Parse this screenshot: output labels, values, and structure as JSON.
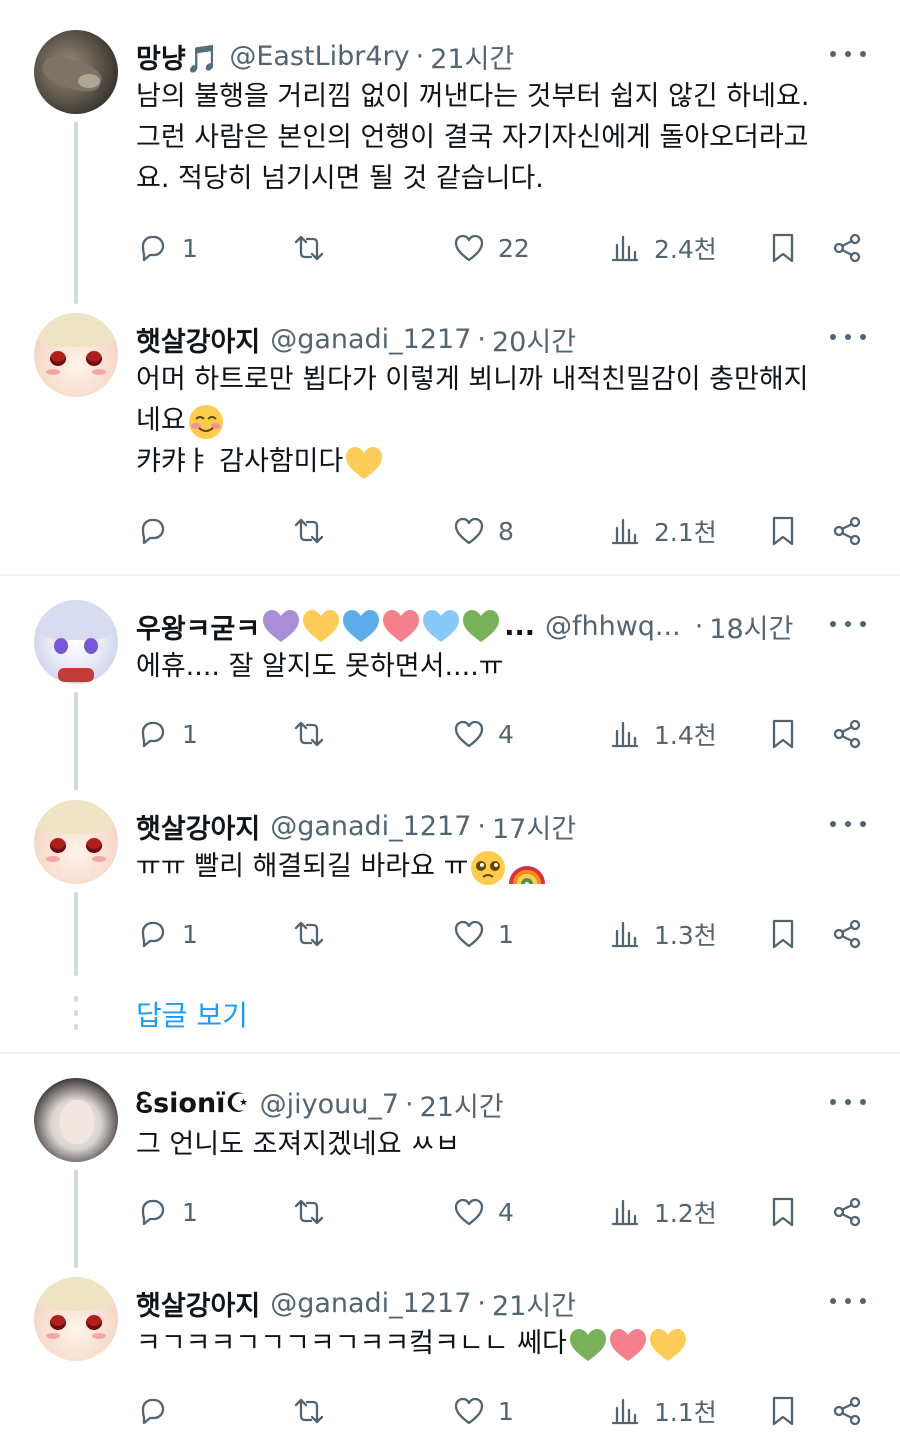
{
  "tweets": [
    {
      "display_name": "망냥🎵",
      "handle": "@EastLibr4ry",
      "dot": "·",
      "time": "21시간",
      "text_lines": [
        "남의 불행을 거리낌 없이 꺼낸다는 것부터 쉽지 않긴 하네요.",
        "그런 사람은 본인의 언행이 결국 자기자신에게 돌아오더라고",
        "요. 적당히 넘기시면 될 것 같습니다."
      ],
      "replies": "1",
      "retweets": "",
      "likes": "22",
      "views": "2.4천",
      "avatar": "cat"
    },
    {
      "display_name": "햇살강아지",
      "handle": "@ganadi_1217",
      "dot": "·",
      "time": "20시간",
      "text_lines": [
        "어머 하트로만 뵙다가 이렇게 뵈니까 내적친밀감이 충만해지",
        "네요",
        "캬캬ㅑ 감사함미다"
      ],
      "replies": "",
      "retweets": "",
      "likes": "8",
      "views": "2.1천",
      "avatar": "puppy"
    },
    {
      "display_name": "우왕ㅋ굳ㅋ",
      "name_suffix": "...",
      "handle": "@fhhwq...",
      "dot": "·",
      "time": "18시간",
      "text_lines": [
        "에휴.... 잘 알지도 못하면서....ㅠ"
      ],
      "replies": "1",
      "retweets": "",
      "likes": "4",
      "views": "1.4천",
      "avatar": "anime"
    },
    {
      "display_name": "햇살강아지",
      "handle": "@ganadi_1217",
      "dot": "·",
      "time": "17시간",
      "text_lines": [
        "ㅠㅠ 빨리 해결되길 바라요 ㅠ"
      ],
      "replies": "1",
      "retweets": "",
      "likes": "1",
      "views": "1.3천",
      "avatar": "puppy"
    },
    {
      "display_name": "Ꮛsionï☪",
      "handle": "@jiyouu_7",
      "dot": "·",
      "time": "21시간",
      "text_lines": [
        "그 언니도 조져지겠네요 ㅆㅂ"
      ],
      "replies": "1",
      "retweets": "",
      "likes": "4",
      "views": "1.2천",
      "avatar": "girl"
    },
    {
      "display_name": "햇살강아지",
      "handle": "@ganadi_1217",
      "dot": "·",
      "time": "21시간",
      "text_lines": [
        "ㅋㄱㅋㅋㄱㄱㄱㅋㄱㅋㅋ컼ㅋㄴㄴ 쎄다"
      ],
      "replies": "",
      "retweets": "",
      "likes": "1",
      "views": "1.1천",
      "avatar": "puppy"
    }
  ],
  "show_replies_label": "답글 보기",
  "colors": {
    "text": "#0f1419",
    "secondary": "#536471",
    "link": "#1d9bf0",
    "divider": "#eff3f4",
    "thread_line": "#cfd9de"
  },
  "icons": [
    "reply-icon",
    "retweet-icon",
    "like-icon",
    "views-icon",
    "bookmark-icon",
    "share-icon",
    "more-icon"
  ]
}
